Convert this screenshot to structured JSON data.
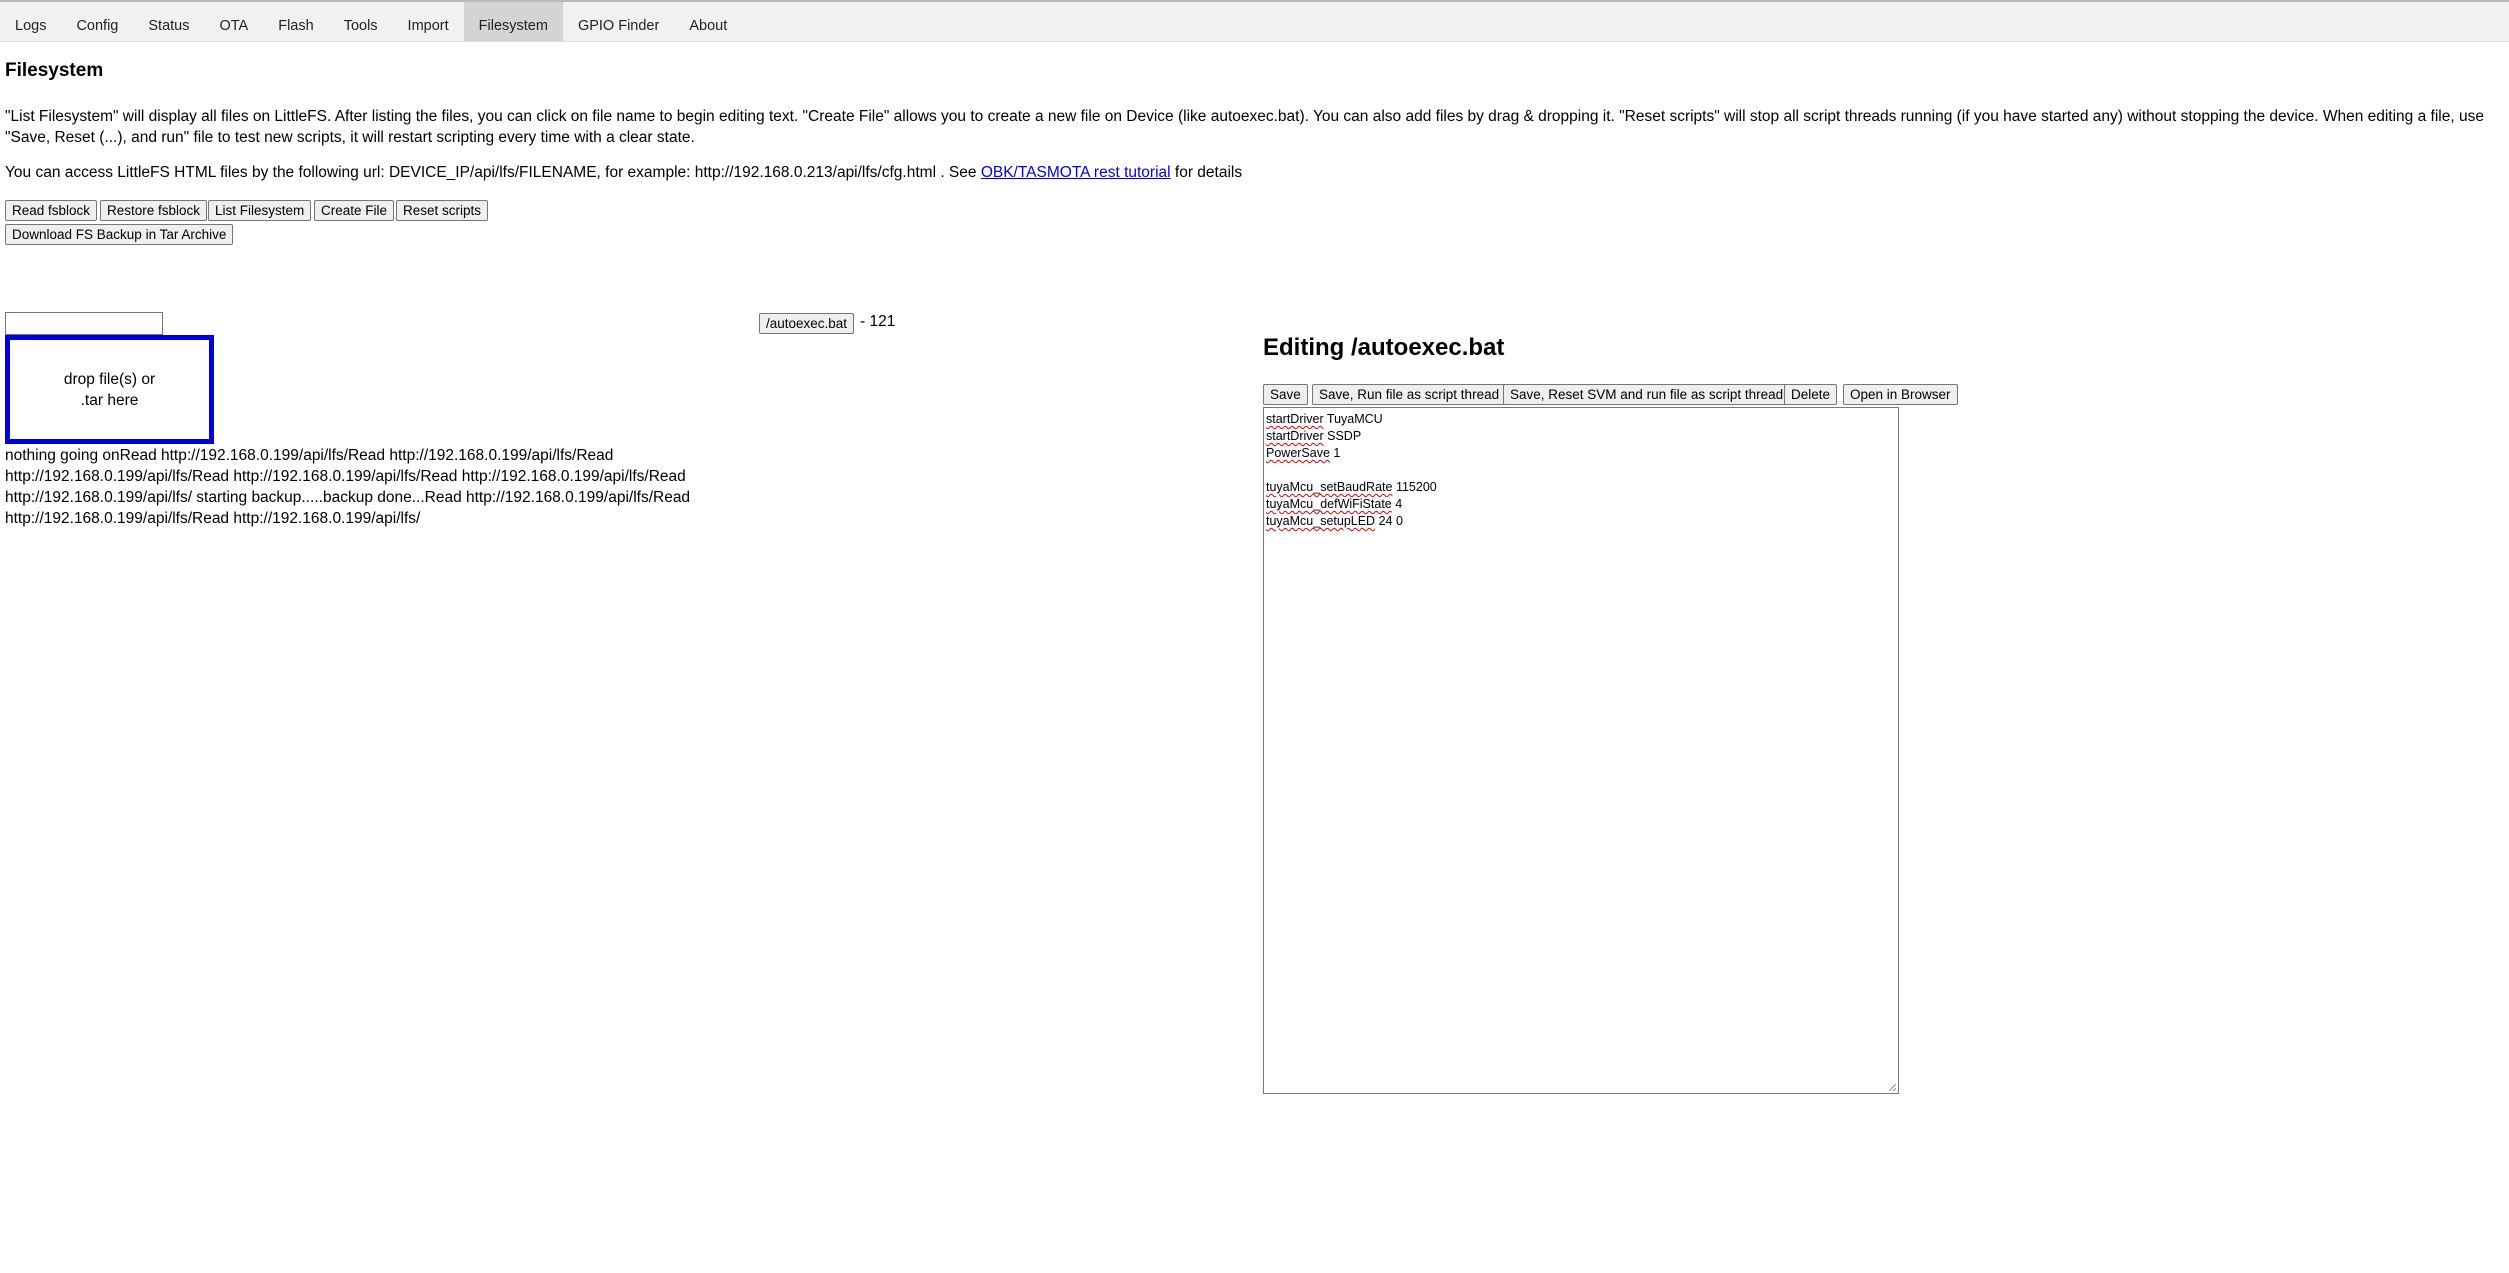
{
  "tabs": [
    {
      "label": "Logs",
      "active": false
    },
    {
      "label": "Config",
      "active": false
    },
    {
      "label": "Status",
      "active": false
    },
    {
      "label": "OTA",
      "active": false
    },
    {
      "label": "Flash",
      "active": false
    },
    {
      "label": "Tools",
      "active": false
    },
    {
      "label": "Import",
      "active": false
    },
    {
      "label": "Filesystem",
      "active": true
    },
    {
      "label": "GPIO Finder",
      "active": false
    },
    {
      "label": "About",
      "active": false
    }
  ],
  "page": {
    "title": "Filesystem",
    "description": "\"List Filesystem\" will display all files on LittleFS. After listing the files, you can click on file name to begin editing text. \"Create File\" allows you to create a new file on Device (like autoexec.bat). You can also add files by drag & dropping it. \"Reset scripts\" will stop all script threads running (if you have started any) without stopping the device. When editing a file, use \"Save, Reset (...), and run\" file to test new scripts, it will restart scripting every time with a clear state.",
    "access_text_before": "You can access LittleFS HTML files by the following url: DEVICE_IP/api/lfs/FILENAME, for example: http://192.168.0.213/api/lfs/cfg.html . See ",
    "access_link": "OBK/TASMOTA rest tutorial",
    "access_text_after": " for details"
  },
  "buttons": {
    "read_fsblock": "Read fsblock",
    "restore_fsblock": "Restore fsblock",
    "list_filesystem": "List Filesystem",
    "create_file": "Create File",
    "reset_scripts": "Reset scripts",
    "download_backup": "Download FS Backup in Tar Archive"
  },
  "filename_input": {
    "value": "",
    "placeholder": ""
  },
  "dropzone": {
    "line1": "drop file(s) or",
    "line2": ".tar here"
  },
  "file_list": [
    {
      "name": "/autoexec.bat",
      "size": "121"
    }
  ],
  "log_text": "nothing going onRead http://192.168.0.199/api/lfs/Read http://192.168.0.199/api/lfs/Read http://192.168.0.199/api/lfs/Read http://192.168.0.199/api/lfs/Read http://192.168.0.199/api/lfs/Read http://192.168.0.199/api/lfs/ starting backup.....backup done...Read http://192.168.0.199/api/lfs/Read http://192.168.0.199/api/lfs/Read http://192.168.0.199/api/lfs/",
  "editor": {
    "heading": "Editing /autoexec.bat",
    "buttons": {
      "save": "Save",
      "save_run": "Save, Run file as script thread",
      "save_reset_run": "Save, Reset SVM and run file as script thread",
      "delete": "Delete",
      "open_browser": "Open in Browser"
    },
    "lines": [
      {
        "cmd": "startDriver",
        "args": " TuyaMCU"
      },
      {
        "cmd": "startDriver",
        "args": " SSDP"
      },
      {
        "cmd": "PowerSave",
        "args": " 1"
      },
      {
        "cmd": "",
        "args": ""
      },
      {
        "cmd": "tuyaMcu_setBaudRate",
        "args": " 115200"
      },
      {
        "cmd": "tuyaMcu_defWiFiState",
        "args": " 4"
      },
      {
        "cmd": "tuyaMcu_setupLED",
        "args": " 24 0"
      }
    ]
  },
  "colors": {
    "dropzone_border": "#0000dd",
    "link": "#0000ee",
    "active_tab": "#d4d4d4"
  }
}
